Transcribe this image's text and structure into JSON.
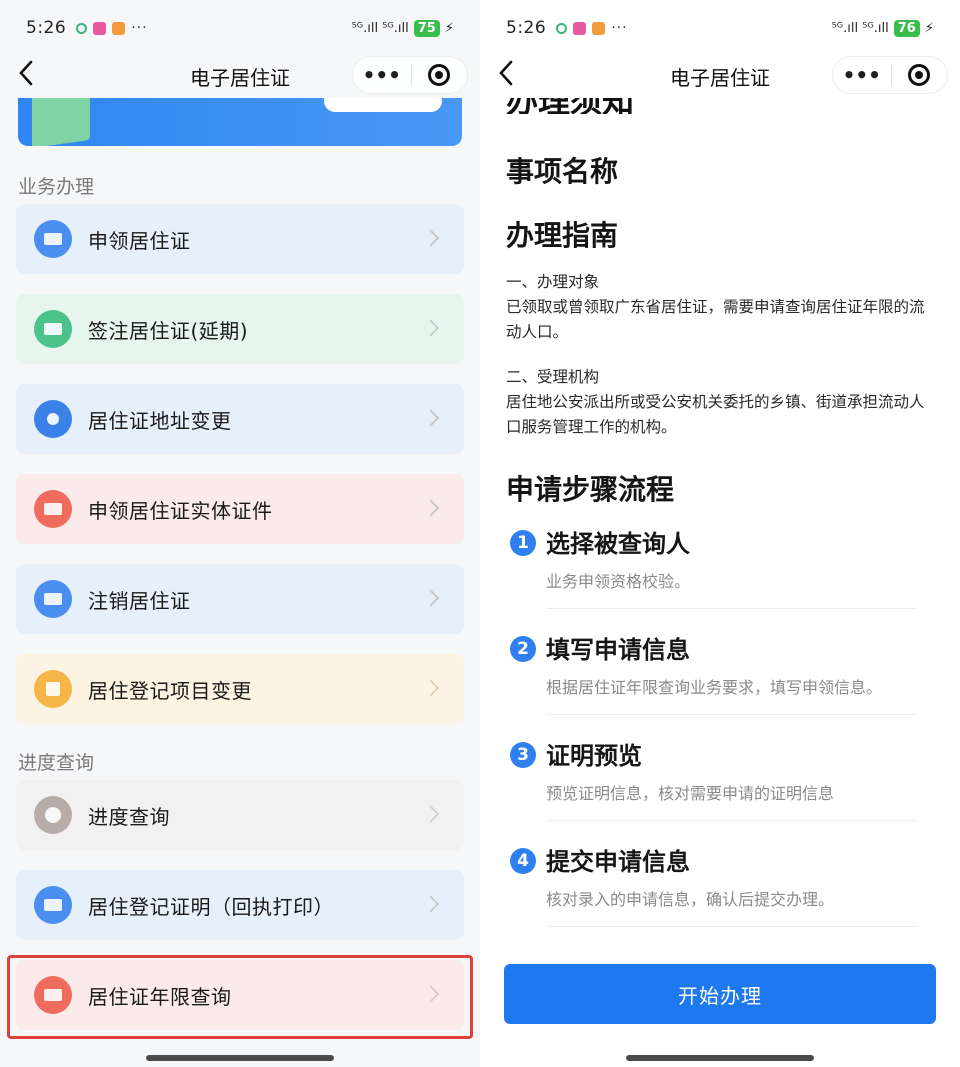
{
  "left": {
    "status": {
      "time": "5:26",
      "more": "···",
      "signal": "⁵ᴳ.ıll ⁵ᴳ.ıll",
      "battery": "75",
      "bolt": "⚡"
    },
    "nav": {
      "title": "电子居住证",
      "more": "•••"
    },
    "sections": [
      {
        "title": "业务办理"
      },
      {
        "title": "进度查询"
      }
    ],
    "services": [
      {
        "label": "申领居住证",
        "icon": "id-card-icon",
        "bg": "#e6f0fb",
        "icon_color": "#4a8ef0"
      },
      {
        "label": "签注居住证(延期)",
        "icon": "endorse-icon",
        "bg": "#e6f6ee",
        "icon_color": "#4cc38a"
      },
      {
        "label": "居住证地址变更",
        "icon": "location-pin-icon",
        "bg": "#e6f0fb",
        "icon_color": "#3b82e8"
      },
      {
        "label": "申领居住证实体证件",
        "icon": "physical-card-icon",
        "bg": "#fbeaea",
        "icon_color": "#ef6b5e"
      },
      {
        "label": "注销居住证",
        "icon": "cancel-card-icon",
        "bg": "#e6f0fb",
        "icon_color": "#4a8ef0"
      },
      {
        "label": "居住登记项目变更",
        "icon": "change-items-icon",
        "bg": "#fcf3e2",
        "icon_color": "#f5b547"
      },
      {
        "label": "进度查询",
        "icon": "search-progress-icon",
        "bg": "#f1f1f1",
        "icon_color": "#b8aca8"
      },
      {
        "label": "居住登记证明（回执打印）",
        "icon": "certificate-print-icon",
        "bg": "#e6f0fb",
        "icon_color": "#4a8ef0"
      },
      {
        "label": "居住证年限查询",
        "icon": "years-query-icon",
        "bg": "#fbeaea",
        "icon_color": "#ef6b5e"
      }
    ]
  },
  "right": {
    "status": {
      "time": "5:26",
      "more": "···",
      "signal": "⁵ᴳ.ıll ⁵ᴳ.ıll",
      "battery": "76",
      "bolt": "⚡"
    },
    "nav": {
      "title": "电子居住证",
      "more": "•••"
    },
    "clipped_heading": "办理须知",
    "item_name_heading": "事项名称",
    "guide_heading": "办理指南",
    "target_heading": "一、办理对象",
    "target_text": "已领取或曾领取广东省居住证，需要申请查询居住证年限的流动人口。",
    "agency_heading": "二、受理机构",
    "agency_text": "居住地公安派出所或受公安机关委托的乡镇、街道承担流动人口服务管理工作的机构。",
    "steps_heading": "申请步骤流程",
    "steps": [
      {
        "num": "1",
        "title": "选择被查询人",
        "desc": "业务申领资格校验。"
      },
      {
        "num": "2",
        "title": "填写申请信息",
        "desc": "根据居住证年限查询业务要求，填写申领信息。"
      },
      {
        "num": "3",
        "title": "证明预览",
        "desc": "预览证明信息，核对需要申请的证明信息"
      },
      {
        "num": "4",
        "title": "提交申请信息",
        "desc": "核对录入的申请信息，确认后提交办理。"
      }
    ],
    "start_button": "开始办理"
  }
}
